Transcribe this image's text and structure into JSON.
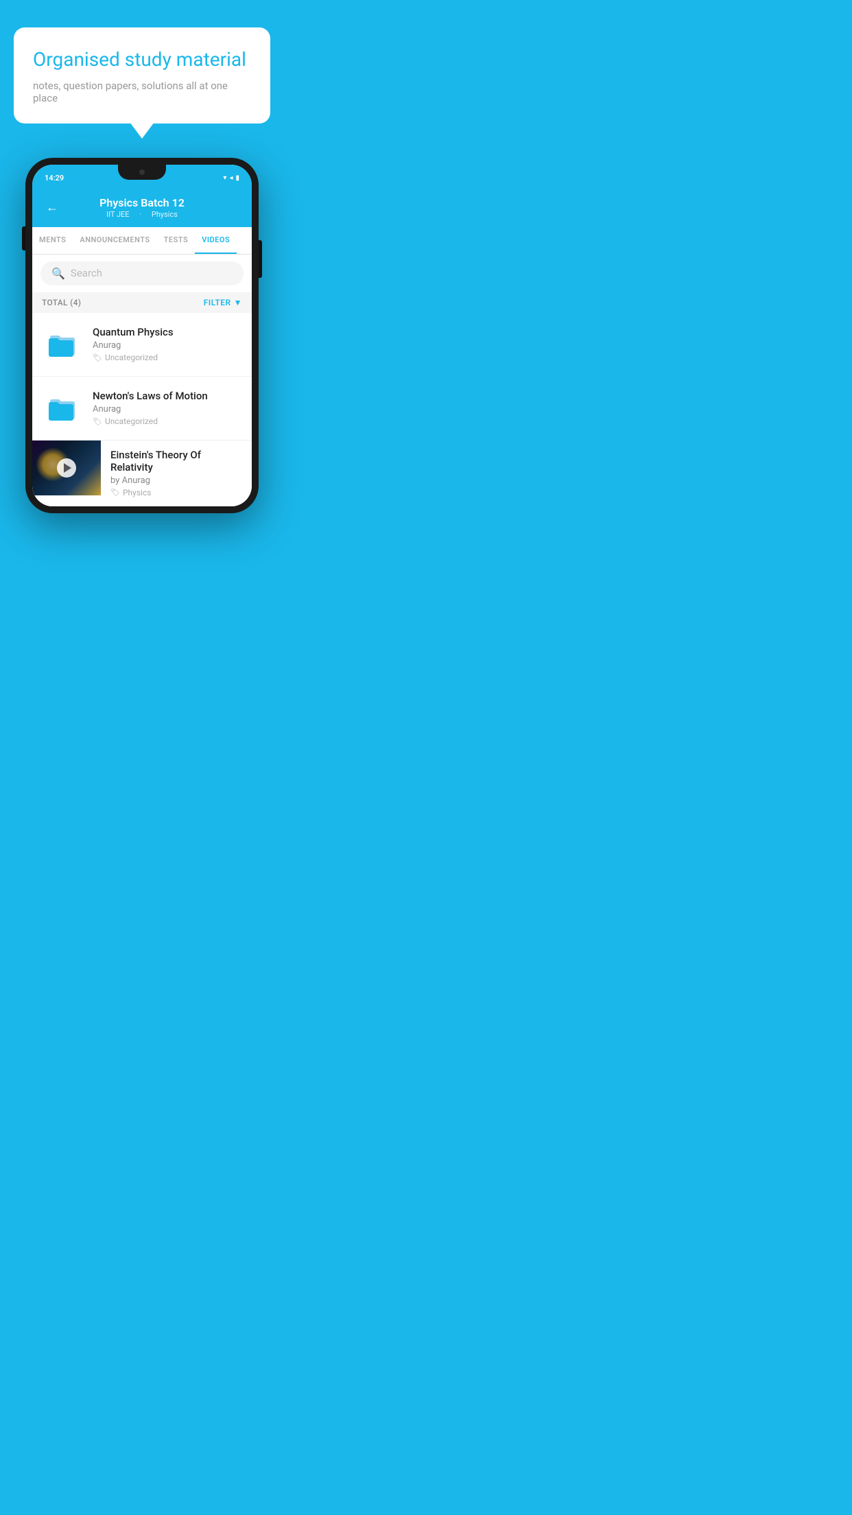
{
  "bubble": {
    "title": "Organised study material",
    "subtitle": "notes, question papers, solutions all at one place"
  },
  "status_bar": {
    "time": "14:29",
    "icons": "▾◂▮"
  },
  "header": {
    "title": "Physics Batch 12",
    "subtitle_part1": "IIT JEE",
    "subtitle_part2": "Physics",
    "back_label": "←"
  },
  "tabs": [
    {
      "label": "MENTS",
      "active": false
    },
    {
      "label": "ANNOUNCEMENTS",
      "active": false
    },
    {
      "label": "TESTS",
      "active": false
    },
    {
      "label": "VIDEOS",
      "active": true
    }
  ],
  "search": {
    "placeholder": "Search"
  },
  "filter_bar": {
    "total_label": "TOTAL (4)",
    "filter_label": "FILTER"
  },
  "videos": [
    {
      "title": "Quantum Physics",
      "author": "Anurag",
      "tag": "Uncategorized",
      "type": "folder"
    },
    {
      "title": "Newton's Laws of Motion",
      "author": "Anurag",
      "tag": "Uncategorized",
      "type": "folder"
    },
    {
      "title": "Einstein's Theory Of Relativity",
      "author": "by Anurag",
      "tag": "Physics",
      "type": "video"
    }
  ]
}
